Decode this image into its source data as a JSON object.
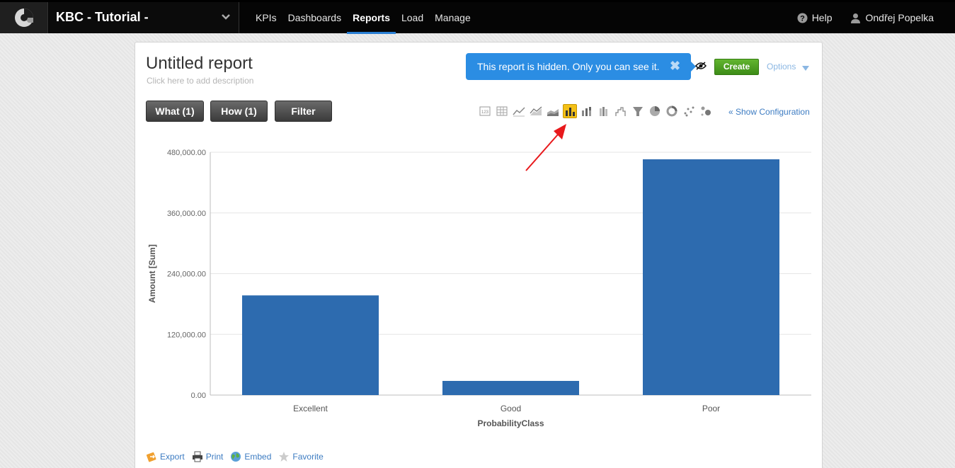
{
  "header": {
    "project_title": "KBC - Tutorial -",
    "nav": [
      {
        "label": "KPIs",
        "active": false
      },
      {
        "label": "Dashboards",
        "active": false
      },
      {
        "label": "Reports",
        "active": true
      },
      {
        "label": "Load",
        "active": false
      },
      {
        "label": "Manage",
        "active": false
      }
    ],
    "help_label": "Help",
    "user_name": "Ondřej Popelka"
  },
  "report": {
    "title": "Untitled report",
    "description_placeholder": "Click here to add description",
    "hidden_notice": "This report is hidden. Only you can see it.",
    "create_label": "Create",
    "options_label": "Options",
    "tabs": {
      "what": "What (1)",
      "how": "How (1)",
      "filter": "Filter"
    },
    "show_configuration": "« Show Configuration",
    "chart_type_icons": [
      "table-number-icon",
      "table-grid-icon",
      "line-chart-icon",
      "area-line-chart-icon",
      "stacked-area-chart-icon",
      "bar-chart-icon",
      "stacked-bar-chart-icon",
      "column-chart-icon",
      "waterfall-chart-icon",
      "funnel-chart-icon",
      "pie-chart-icon",
      "donut-chart-icon",
      "scatter-chart-icon",
      "bubble-chart-icon"
    ],
    "selected_chart_icon": "bar-chart-icon",
    "footer": {
      "export": "Export",
      "print": "Print",
      "embed": "Embed",
      "favorite": "Favorite"
    }
  },
  "colors": {
    "bar": "#2d6baf",
    "accent": "#2a7fd4",
    "notice": "#2b8de3",
    "create": "#4ea321"
  },
  "chart_data": {
    "type": "bar",
    "categories": [
      "Excellent",
      "Good",
      "Poor"
    ],
    "values": [
      197000,
      28000,
      466000
    ],
    "xlabel": "ProbabilityClass",
    "ylabel": "Amount [Sum]",
    "ylim": [
      0,
      480000
    ],
    "yticks": [
      "0.00",
      "120,000.00",
      "240,000.00",
      "360,000.00",
      "480,000.00"
    ],
    "grid": true
  }
}
